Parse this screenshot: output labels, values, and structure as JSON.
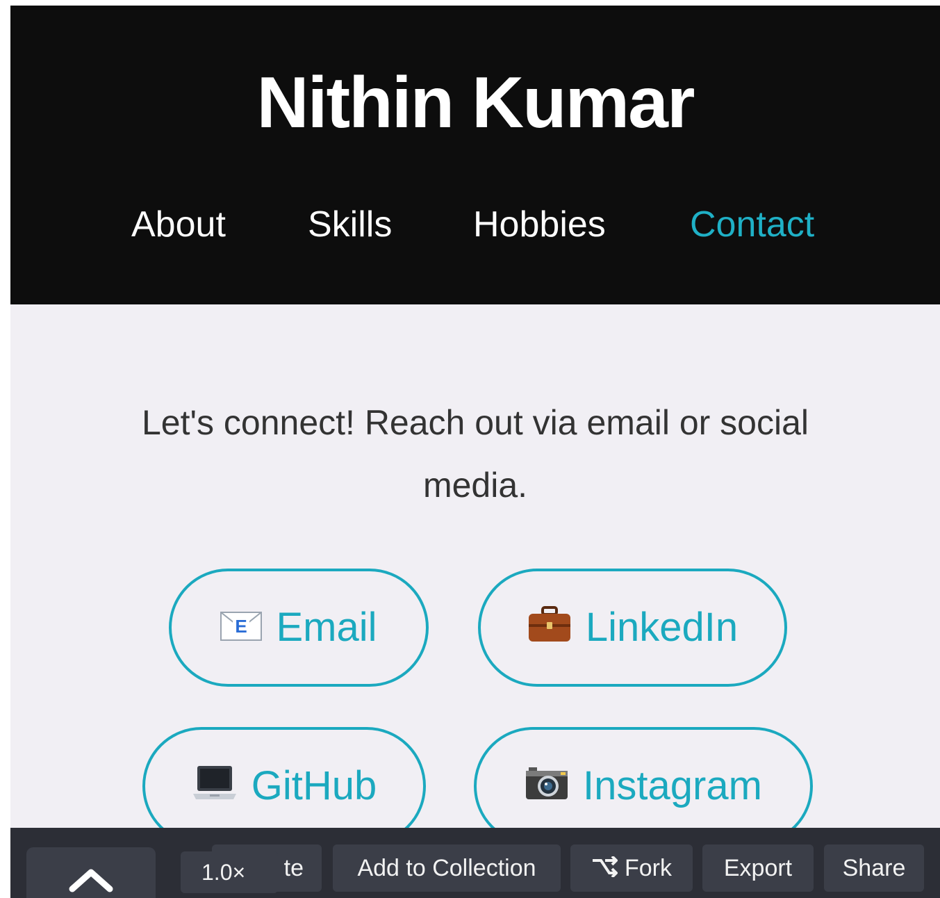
{
  "header": {
    "title": "Nithin Kumar",
    "nav": [
      {
        "label": "About",
        "active": false
      },
      {
        "label": "Skills",
        "active": false
      },
      {
        "label": "Hobbies",
        "active": false
      },
      {
        "label": "Contact",
        "active": true
      }
    ]
  },
  "contact": {
    "intro": "Let's connect! Reach out via email or social media.",
    "links": [
      {
        "label": "Email",
        "icon": "envelope-icon"
      },
      {
        "label": "LinkedIn",
        "icon": "briefcase-icon"
      },
      {
        "label": "GitHub",
        "icon": "laptop-icon"
      },
      {
        "label": "Instagram",
        "icon": "camera-icon"
      }
    ]
  },
  "toolbar": {
    "zoom": "1.0×",
    "partial_label": "te",
    "add_to_collection": "Add to Collection",
    "fork": "Fork",
    "export": "Export",
    "share": "Share"
  },
  "colors": {
    "accent": "#1ba9bf",
    "header_bg": "#0d0d0d",
    "page_bg": "#f1eff4",
    "toolbar_bg": "#2c2e36"
  }
}
